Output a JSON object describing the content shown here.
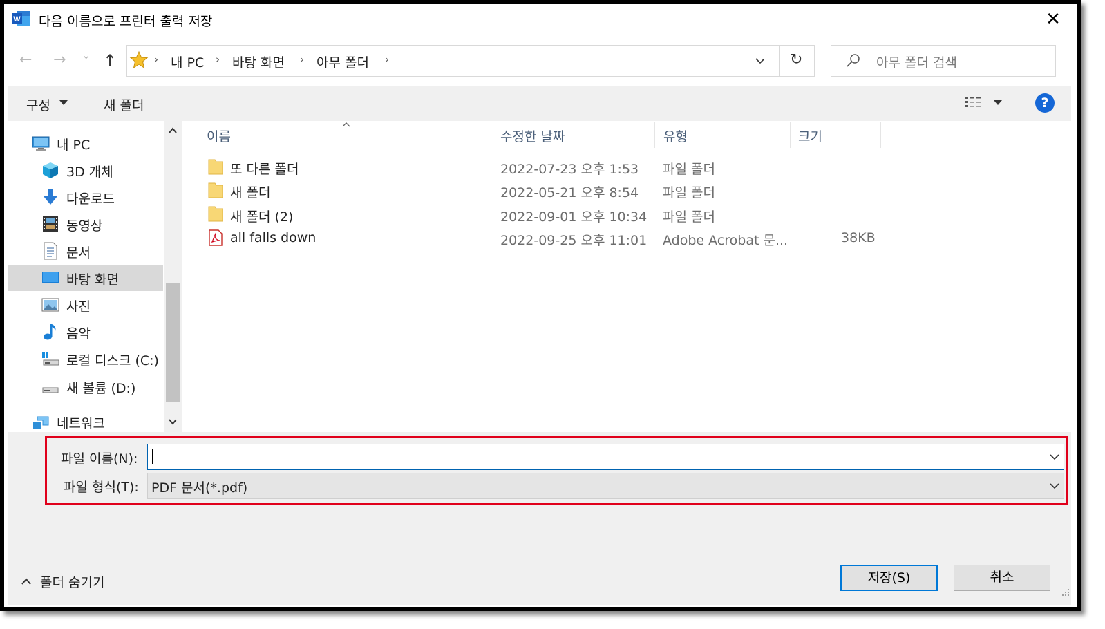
{
  "window": {
    "title": "다음 이름으로 프린터 출력 저장",
    "close_glyph": "✕"
  },
  "nav": {
    "back_glyph": "←",
    "forward_glyph": "→",
    "recent_glyph": "⌄",
    "up_glyph": "↑",
    "breadcrumb": [
      "내 PC",
      "바탕 화면",
      "아무 폴더"
    ],
    "refresh_glyph": "↻",
    "search_placeholder": "아무 폴더 검색"
  },
  "toolbar": {
    "organize_label": "구성",
    "new_folder_label": "새 폴더",
    "help_label": "?"
  },
  "sidebar": {
    "items": [
      {
        "label": "내 PC",
        "icon": "computer-icon"
      },
      {
        "label": "3D 개체",
        "icon": "cube-icon"
      },
      {
        "label": "다운로드",
        "icon": "download-icon"
      },
      {
        "label": "동영상",
        "icon": "video-icon"
      },
      {
        "label": "문서",
        "icon": "document-icon"
      },
      {
        "label": "바탕 화면",
        "icon": "desktop-icon",
        "selected": true
      },
      {
        "label": "사진",
        "icon": "picture-icon"
      },
      {
        "label": "음악",
        "icon": "music-icon"
      },
      {
        "label": "로컬 디스크 (C:)",
        "icon": "system-drive-icon"
      },
      {
        "label": "새 볼륨 (D:)",
        "icon": "drive-icon"
      },
      {
        "label": "네트워크",
        "icon": "network-icon"
      }
    ]
  },
  "file_list": {
    "columns": [
      "이름",
      "수정한 날짜",
      "유형",
      "크기"
    ],
    "rows": [
      {
        "name": "또 다른 폴더",
        "modified": "2022-07-23 오후 1:53",
        "type": "파일 폴더",
        "size": "",
        "icon": "folder-icon"
      },
      {
        "name": "새 폴더",
        "modified": "2022-05-21 오후 8:54",
        "type": "파일 폴더",
        "size": "",
        "icon": "folder-icon"
      },
      {
        "name": "새 폴더 (2)",
        "modified": "2022-09-01 오후 10:34",
        "type": "파일 폴더",
        "size": "",
        "icon": "folder-icon"
      },
      {
        "name": "all falls down",
        "modified": "2022-09-25 오후 11:01",
        "type": "Adobe Acrobat 문...",
        "size": "38KB",
        "icon": "pdf-icon"
      }
    ]
  },
  "form": {
    "filename_label": "파일 이름(N):",
    "filename_value": "",
    "filetype_label": "파일 형식(T):",
    "filetype_value": "PDF 문서(*.pdf)"
  },
  "footer": {
    "hide_folders_label": "폴더 숨기기",
    "save_label": "저장(S)",
    "cancel_label": "취소"
  },
  "colors": {
    "accent": "#0078d7",
    "highlight_box": "#e0001b",
    "selected_bg": "#d9d9d9"
  }
}
